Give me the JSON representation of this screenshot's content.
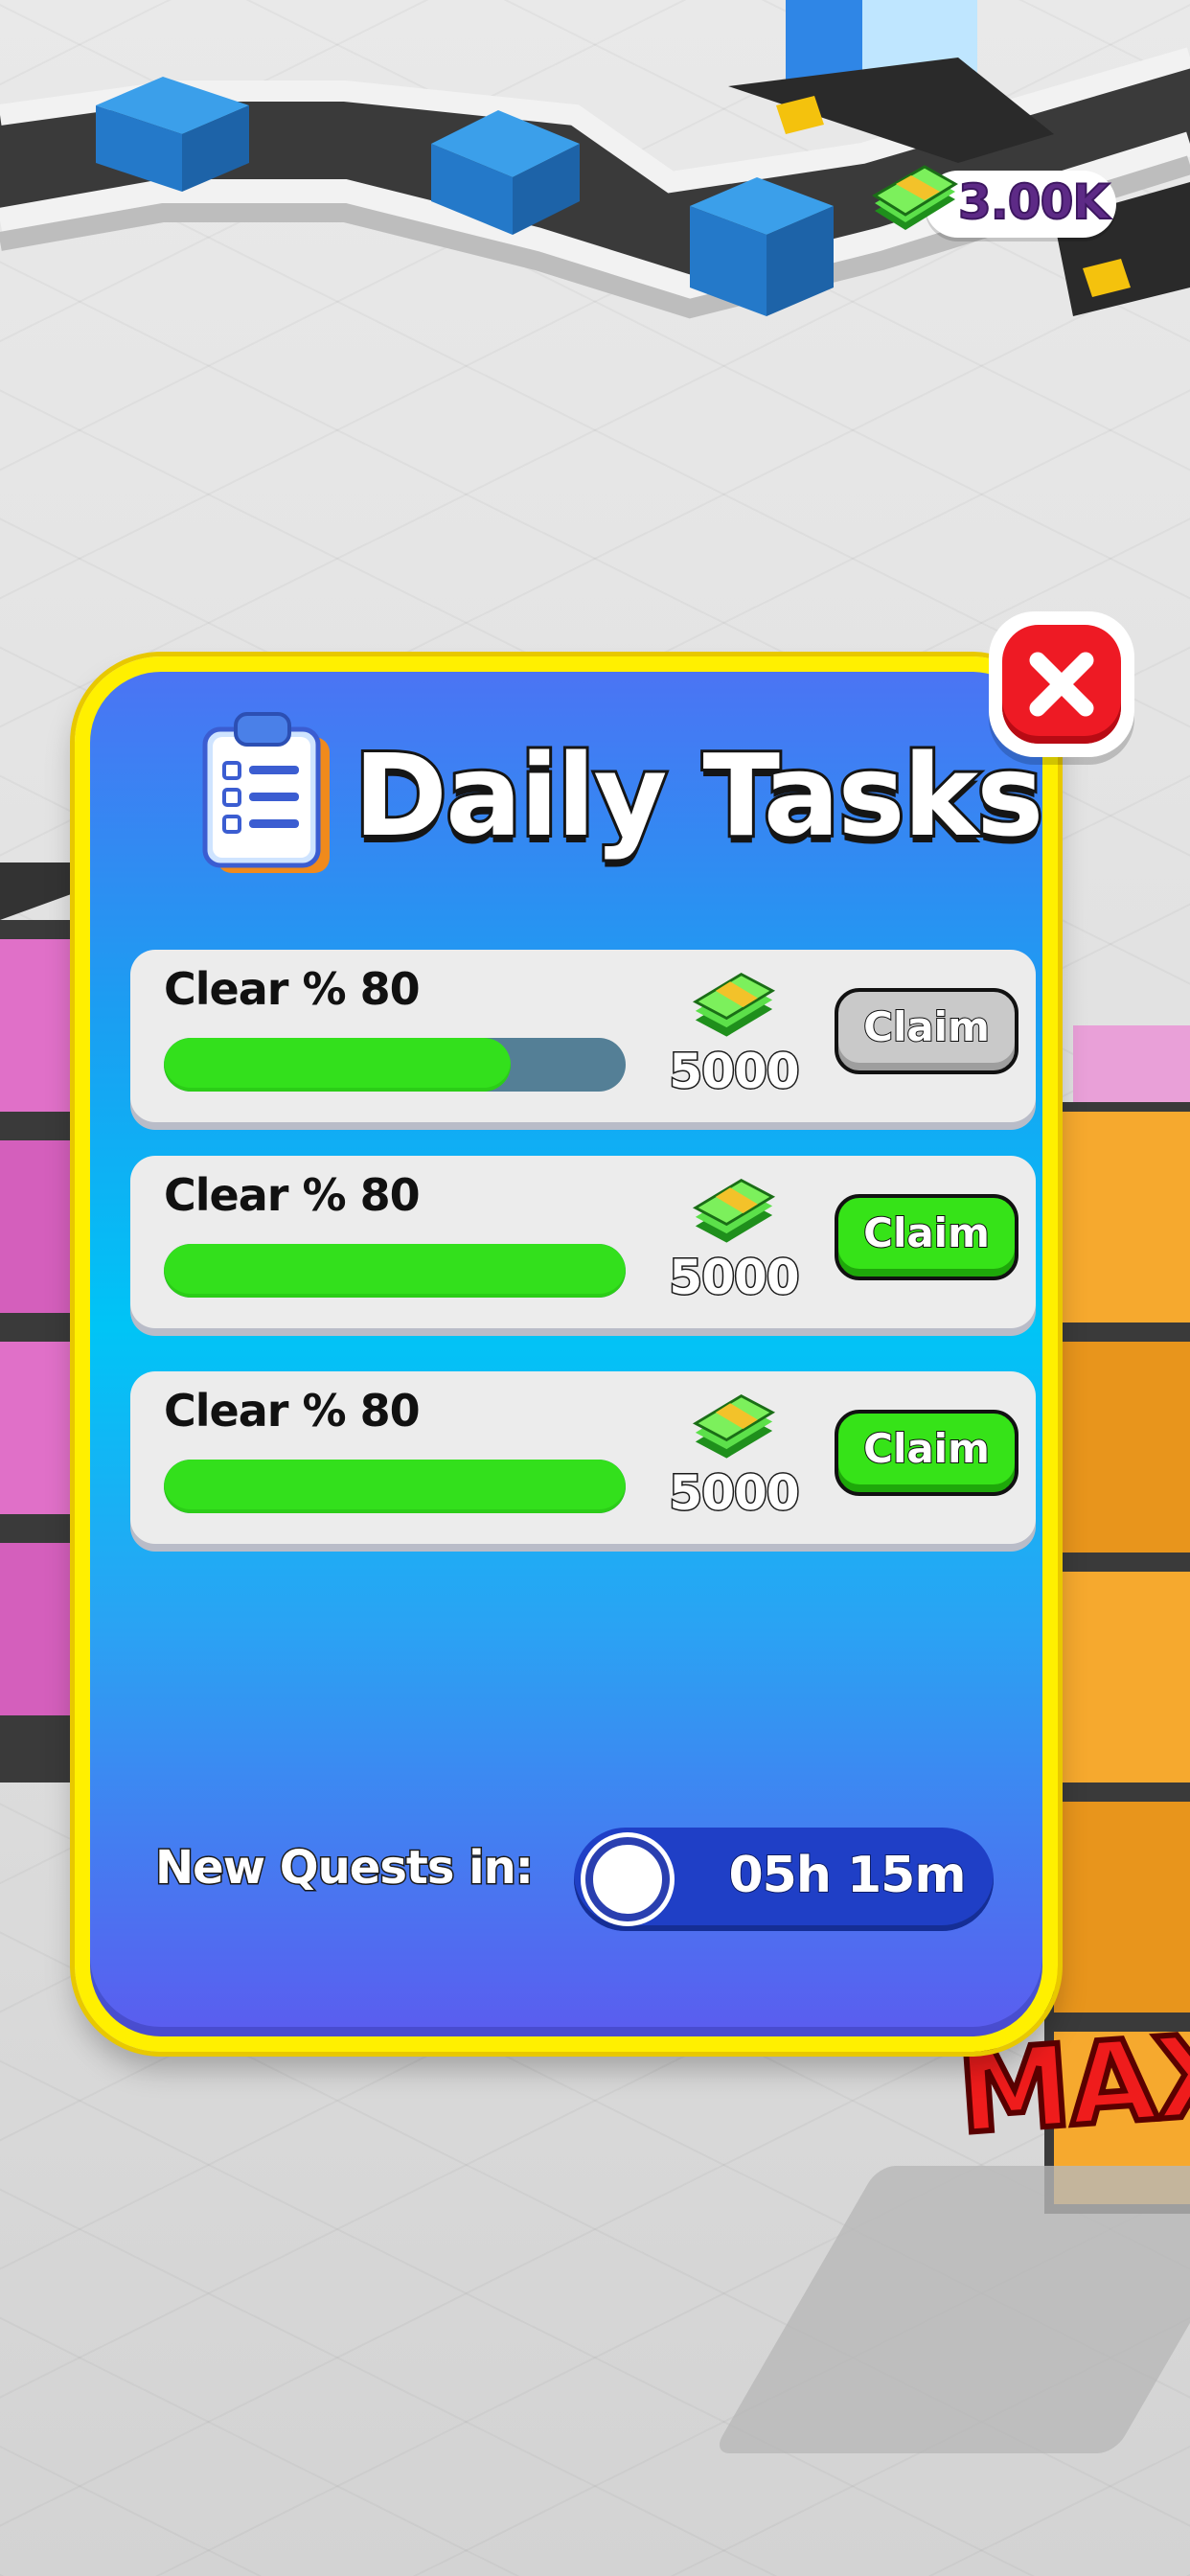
{
  "hud": {
    "cash_total": "3.00K"
  },
  "dialog": {
    "title": "Daily Tasks",
    "tasks": [
      {
        "label": "Clear % 80",
        "reward": "5000",
        "claim_label": "Claim",
        "claim_state": "disabled",
        "progress": 0.75
      },
      {
        "label": "Clear % 80",
        "reward": "5000",
        "claim_label": "Claim",
        "claim_state": "active",
        "progress": 1.0
      },
      {
        "label": "Clear % 80",
        "reward": "5000",
        "claim_label": "Claim",
        "claim_state": "active",
        "progress": 1.0
      }
    ],
    "footer": {
      "label": "New Quests in:",
      "timer": "05h 15m"
    }
  },
  "background": {
    "max_label": "MAX"
  },
  "colors": {
    "dialog_border": "#fff000",
    "progress_fill": "#33e01c",
    "progress_track": "#547f96",
    "claim_active": "#36e318",
    "claim_disabled": "#c9c9c9",
    "close_button": "#ee1a24"
  },
  "icons": {
    "close": "close-x-icon",
    "title": "clipboard-icon",
    "reward": "cash-stack-icon",
    "timer": "clock-icon"
  }
}
